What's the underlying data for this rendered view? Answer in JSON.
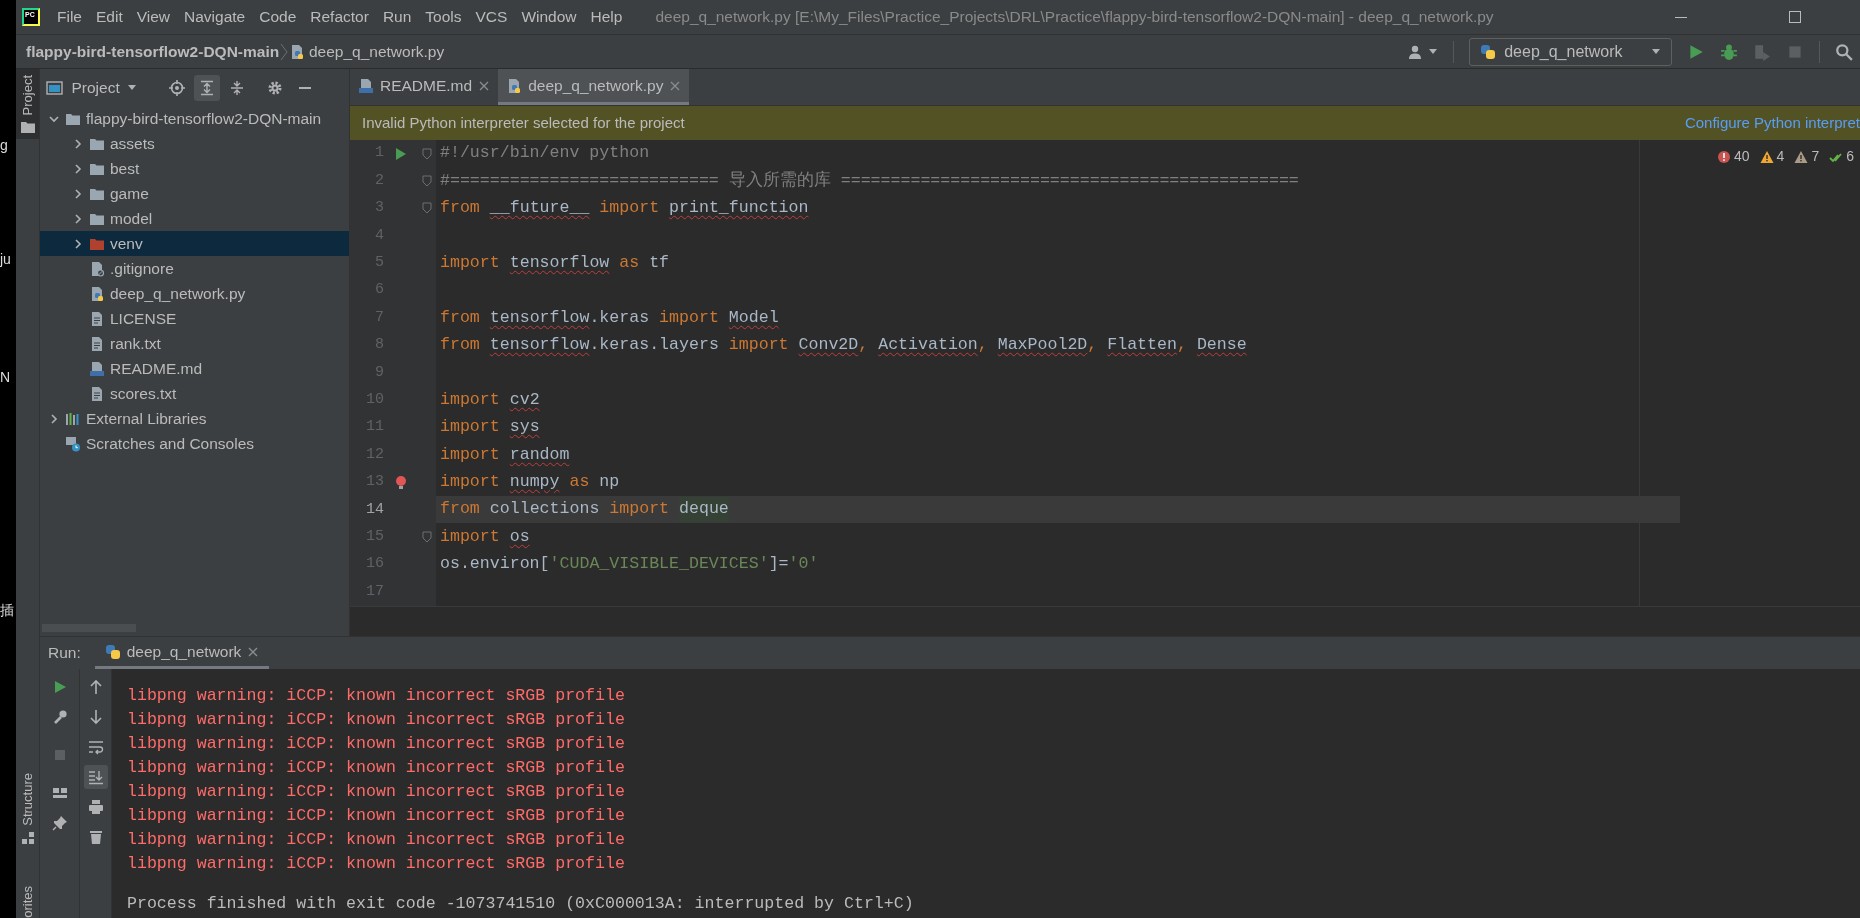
{
  "window": {
    "logo": "PC",
    "title": "deep_q_network.py [E:\\My_Files\\Practice_Projects\\DRL\\Practice\\flappy-bird-tensorflow2-DQN-main] - deep_q_network.py"
  },
  "background_fragments": [
    "g",
    "ju",
    "N",
    "插"
  ],
  "menu": [
    "File",
    "Edit",
    "View",
    "Navigate",
    "Code",
    "Refactor",
    "Run",
    "Tools",
    "VCS",
    "Window",
    "Help"
  ],
  "breadcrumb": {
    "project": "flappy-bird-tensorflow2-DQN-main",
    "file": "deep_q_network.py"
  },
  "toolbar": {
    "run_config": "deep_q_network",
    "buttons": [
      {
        "kind": "run",
        "disabled": false
      },
      {
        "kind": "debug",
        "disabled": false
      },
      {
        "kind": "coverage",
        "disabled": true
      },
      {
        "kind": "stop",
        "disabled": true
      },
      {
        "kind": "search",
        "disabled": false
      }
    ]
  },
  "tool_stripe": {
    "top": [
      {
        "label": "Project",
        "selected": true
      }
    ],
    "bottom": [
      {
        "label": "Structure",
        "selected": false
      },
      {
        "label": "orites",
        "selected": false
      }
    ]
  },
  "project_panel": {
    "title": "Project",
    "tools": [
      {
        "kind": "locate",
        "selected": false
      },
      {
        "kind": "expand",
        "selected": true
      },
      {
        "kind": "collapse",
        "selected": false
      },
      {
        "kind": "settings",
        "selected": false
      },
      {
        "kind": "hide",
        "selected": false
      }
    ],
    "tree": [
      {
        "label": "flappy-bird-tensorflow2-DQN-main",
        "kind": "folder",
        "expanded": true,
        "selected": false,
        "children": [
          {
            "label": "assets",
            "kind": "folder",
            "expanded": false,
            "selected": false
          },
          {
            "label": "best",
            "kind": "folder",
            "expanded": false,
            "selected": false
          },
          {
            "label": "game",
            "kind": "folder",
            "expanded": false,
            "selected": false
          },
          {
            "label": "model",
            "kind": "folder",
            "expanded": false,
            "selected": false
          },
          {
            "label": "venv",
            "kind": "excluded_folder",
            "expanded": false,
            "selected": true
          },
          {
            "label": ".gitignore",
            "kind": "gitignore",
            "selected": false
          },
          {
            "label": "deep_q_network.py",
            "kind": "python",
            "selected": false
          },
          {
            "label": "LICENSE",
            "kind": "text",
            "selected": false
          },
          {
            "label": "rank.txt",
            "kind": "text",
            "selected": false
          },
          {
            "label": "README.md",
            "kind": "markdown",
            "selected": false
          },
          {
            "label": "scores.txt",
            "kind": "text",
            "selected": false
          }
        ]
      },
      {
        "label": "External Libraries",
        "kind": "libraries",
        "expanded": false,
        "selected": false
      },
      {
        "label": "Scratches and Consoles",
        "kind": "scratches",
        "selected": false
      }
    ]
  },
  "tabs": [
    {
      "label": "README.md",
      "kind": "markdown",
      "selected": false
    },
    {
      "label": "deep_q_network.py",
      "kind": "python",
      "selected": true
    }
  ],
  "banner": {
    "message": "Invalid Python interpreter selected for the project",
    "action": "Configure Python interpret"
  },
  "inspections": [
    {
      "kind": "error",
      "count": "40"
    },
    {
      "kind": "warning",
      "count": "4"
    },
    {
      "kind": "weak_warning",
      "count": "7"
    },
    {
      "kind": "typo",
      "count": "6"
    }
  ],
  "code_lines": [
    {
      "number": "1",
      "kind": "runnable",
      "selected": false,
      "fold": true,
      "tokens": [
        {
          "text": "#!/usr/bin/env python",
          "kind": "comment"
        }
      ]
    },
    {
      "number": "2",
      "kind": "plain",
      "selected": false,
      "fold": true,
      "tokens": [
        {
          "text": "#=========================== 导入所需的库 ==============================================",
          "kind": "comment"
        }
      ]
    },
    {
      "number": "3",
      "kind": "plain",
      "selected": false,
      "fold": true,
      "tokens": [
        {
          "text": "from ",
          "kind": "kw"
        },
        {
          "text": "__future__",
          "kind": "name",
          "error": true
        },
        {
          "text": " import ",
          "kind": "kw"
        },
        {
          "text": "print_function",
          "kind": "name",
          "error": true
        }
      ]
    },
    {
      "number": "4",
      "kind": "plain",
      "selected": false,
      "fold": false
    },
    {
      "number": "5",
      "kind": "plain",
      "selected": false,
      "fold": false,
      "tokens": [
        {
          "text": "import ",
          "kind": "kw"
        },
        {
          "text": "tensorflow",
          "kind": "name",
          "error": true
        },
        {
          "text": " as ",
          "kind": "kw"
        },
        {
          "text": "tf",
          "kind": "plain"
        }
      ]
    },
    {
      "number": "6",
      "kind": "plain",
      "selected": false,
      "fold": false
    },
    {
      "number": "7",
      "kind": "plain",
      "selected": false,
      "fold": false,
      "tokens": [
        {
          "text": "from ",
          "kind": "kw"
        },
        {
          "text": "tensorflow",
          "kind": "name",
          "error": true
        },
        {
          "text": ".keras",
          "kind": "plain"
        },
        {
          "text": " import ",
          "kind": "kw"
        },
        {
          "text": "Model",
          "kind": "name",
          "error": true
        }
      ]
    },
    {
      "number": "8",
      "kind": "plain",
      "selected": false,
      "fold": false,
      "tokens": [
        {
          "text": "from ",
          "kind": "kw"
        },
        {
          "text": "tensorflow",
          "kind": "name",
          "error": true
        },
        {
          "text": ".keras.layers",
          "kind": "plain"
        },
        {
          "text": " import ",
          "kind": "kw"
        },
        {
          "text": "Conv2D",
          "kind": "name",
          "error": true
        },
        {
          "text": ", ",
          "kind": "punct"
        },
        {
          "text": "Activation",
          "kind": "name",
          "error": true
        },
        {
          "text": ", ",
          "kind": "punct"
        },
        {
          "text": "MaxPool2D",
          "kind": "name",
          "error": true
        },
        {
          "text": ", ",
          "kind": "punct"
        },
        {
          "text": "Flatten",
          "kind": "name",
          "error": true
        },
        {
          "text": ", ",
          "kind": "punct"
        },
        {
          "text": "Dense",
          "kind": "name",
          "error": true
        }
      ]
    },
    {
      "number": "9",
      "kind": "plain",
      "selected": false,
      "fold": false
    },
    {
      "number": "10",
      "kind": "plain",
      "selected": false,
      "fold": false,
      "tokens": [
        {
          "text": "import ",
          "kind": "kw"
        },
        {
          "text": "cv2",
          "kind": "name",
          "error": true
        }
      ]
    },
    {
      "number": "11",
      "kind": "plain",
      "selected": false,
      "fold": false,
      "tokens": [
        {
          "text": "import ",
          "kind": "kw"
        },
        {
          "text": "sys",
          "kind": "name",
          "error": true
        }
      ]
    },
    {
      "number": "12",
      "kind": "plain",
      "selected": false,
      "fold": false,
      "tokens": [
        {
          "text": "import ",
          "kind": "kw"
        },
        {
          "text": "random",
          "kind": "name",
          "error": true
        }
      ]
    },
    {
      "number": "13",
      "kind": "hint",
      "selected": false,
      "fold": false,
      "tokens": [
        {
          "text": "import ",
          "kind": "kw"
        },
        {
          "text": "numpy",
          "kind": "name",
          "error": true
        },
        {
          "text": " as ",
          "kind": "kw"
        },
        {
          "text": "np",
          "kind": "plain"
        }
      ]
    },
    {
      "number": "14",
      "kind": "plain",
      "selected": true,
      "fold": false,
      "tokens": [
        {
          "text": "from",
          "kind": "kw"
        },
        {
          "text": " collections ",
          "kind": "plain"
        },
        {
          "text": "import ",
          "kind": "kw"
        },
        {
          "text": "deque",
          "kind": "usage"
        }
      ]
    },
    {
      "number": "15",
      "kind": "plain",
      "selected": false,
      "fold": true,
      "tokens": [
        {
          "text": "import ",
          "kind": "kw"
        },
        {
          "text": "os",
          "kind": "name",
          "error": true
        }
      ]
    },
    {
      "number": "16",
      "kind": "plain",
      "selected": false,
      "fold": false,
      "tokens": [
        {
          "text": "os.environ[",
          "kind": "plain"
        },
        {
          "text": "'CUDA_VISIBLE_DEVICES'",
          "kind": "str"
        },
        {
          "text": "]=",
          "kind": "plain"
        },
        {
          "text": "'0'",
          "kind": "str"
        }
      ]
    },
    {
      "number": "17",
      "kind": "plain",
      "selected": false,
      "fold": false
    }
  ],
  "run_panel": {
    "label": "Run:",
    "tabs": [
      {
        "label": "deep_q_network",
        "selected": true
      }
    ],
    "tools_left": [
      {
        "kind": "rerun",
        "disabled": false
      },
      {
        "kind": "settings",
        "disabled": false
      },
      {
        "kind": "stop",
        "disabled": true
      },
      {
        "kind": "layout",
        "disabled": false
      },
      {
        "kind": "pin",
        "disabled": false
      }
    ],
    "tools_right": [
      {
        "kind": "up",
        "selected": false
      },
      {
        "kind": "down",
        "selected": false
      },
      {
        "kind": "wrap",
        "selected": false
      },
      {
        "kind": "scroll_end",
        "selected": true
      },
      {
        "kind": "print",
        "selected": false
      },
      {
        "kind": "clear",
        "selected": false
      }
    ],
    "output": [
      {
        "text": "libpng warning: iCCP: known incorrect sRGB profile",
        "kind": "error"
      },
      {
        "text": "libpng warning: iCCP: known incorrect sRGB profile",
        "kind": "error"
      },
      {
        "text": "libpng warning: iCCP: known incorrect sRGB profile",
        "kind": "error"
      },
      {
        "text": "libpng warning: iCCP: known incorrect sRGB profile",
        "kind": "error"
      },
      {
        "text": "libpng warning: iCCP: known incorrect sRGB profile",
        "kind": "error"
      },
      {
        "text": "libpng warning: iCCP: known incorrect sRGB profile",
        "kind": "error"
      },
      {
        "text": "libpng warning: iCCP: known incorrect sRGB profile",
        "kind": "error"
      },
      {
        "text": "libpng warning: iCCP: known incorrect sRGB profile",
        "kind": "error"
      },
      {
        "text": "Process finished with exit code -1073741510 (0xC000013A: interrupted by Ctrl+C)",
        "kind": "info"
      }
    ]
  }
}
